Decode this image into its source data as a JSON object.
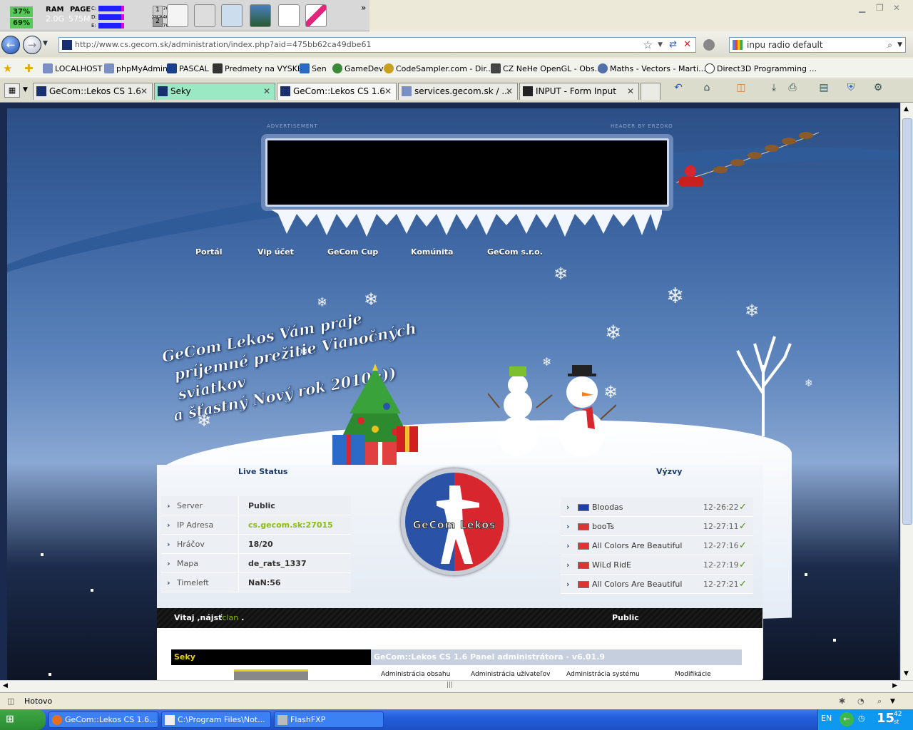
{
  "monitor": {
    "cpu1": "37%",
    "cpu2": "69%",
    "ram_label": "RAM",
    "ram_value": "2.0G",
    "page_label": "PAGE",
    "page_value": "575M",
    "drives": [
      {
        "letter": "C:",
        "value": "4.77G"
      },
      {
        "letter": "D:",
        "value": "29.84G"
      },
      {
        "letter": "E:",
        "value": "5.27G"
      }
    ],
    "desk1": "1",
    "desk2": "2",
    "more": "»"
  },
  "browser": {
    "url": "http://www.cs.gecom.sk/administration/index.php?aid=475bb62ca49dbe61",
    "search": "inpu radio default",
    "favorites": [
      "LOCALHOST",
      "phpMyAdmin",
      "PASCAL",
      "Predmety na VYSKE",
      "Sen",
      "GameDev",
      "CodeSampler.com - Dir...",
      "CZ NeHe OpenGL - Obs...",
      "Maths - Vectors - Marti...",
      "Direct3D Programming ..."
    ],
    "tabs": [
      {
        "label": "GeCom::Lekos CS 1.6",
        "state": "normal"
      },
      {
        "label": "Seky",
        "state": "green"
      },
      {
        "label": "GeCom::Lekos CS 1.6",
        "state": "active"
      },
      {
        "label": "services.gecom.sk / ...",
        "state": "normal"
      },
      {
        "label": "INPUT - Form Input",
        "state": "normal"
      }
    ]
  },
  "site": {
    "ad_label": "ADVERTISEMENT",
    "header_credit": "HEADER BY ERZOKO",
    "nav": [
      "Portál",
      "Vip účet",
      "GeCom Cup",
      "Komúnita",
      "GeCom s.r.o."
    ],
    "greeting": [
      "GeCom Lekos Vám praje",
      "príjemné prežitie Vianočných sviatkov",
      "a šťastný Nový rok 2010 :))"
    ],
    "live_status_title": "Live Status",
    "challenges_title": "Výzvy",
    "logo_text": "GeCom Lekos",
    "status": [
      {
        "key": "Server",
        "value": "Public",
        "green": false
      },
      {
        "key": "IP Adresa",
        "value": "cs.gecom.sk:27015",
        "green": true
      },
      {
        "key": "Hráčov",
        "value": "18/20",
        "green": false
      },
      {
        "key": "Mapa",
        "value": "de_rats_1337",
        "green": false
      },
      {
        "key": "Timeleft",
        "value": "NaN:56",
        "green": false
      }
    ],
    "challenges": [
      {
        "name": "Bloodas",
        "time": "12-26:22",
        "flag": "#1d3fa8"
      },
      {
        "name": "booTs",
        "time": "12-27:11",
        "flag": "#d33"
      },
      {
        "name": "All Colors Are Beautiful",
        "time": "12-27:16",
        "flag": "#d33"
      },
      {
        "name": "WiLd RidE",
        "time": "12-27:19",
        "flag": "#d33"
      },
      {
        "name": "All Colors Are Beautiful",
        "time": "12-27:21",
        "flag": "#d33"
      }
    ],
    "welcome_prefix": "Vitaj ,nájsť",
    "welcome_clan": "clan",
    "welcome_suffix": ".",
    "bar_right": "Public",
    "seky": "Seky",
    "admin_title": "GeCom::Lekos CS 1.6 Panel administrátora - v6.01.9",
    "admin_menu": [
      "Administrácia obsahu",
      "Administrácia užívateľov",
      "Administrácia systému",
      "Modifikácie"
    ]
  },
  "statusbar": {
    "text": "Hotovo"
  },
  "taskbar": {
    "tasks": [
      "GeCom::Lekos CS 1.6...",
      "C:\\Program Files\\Not...",
      "FlashFXP"
    ],
    "lang": "EN",
    "time": "15",
    "time_min": "42",
    "time_day": "st"
  }
}
